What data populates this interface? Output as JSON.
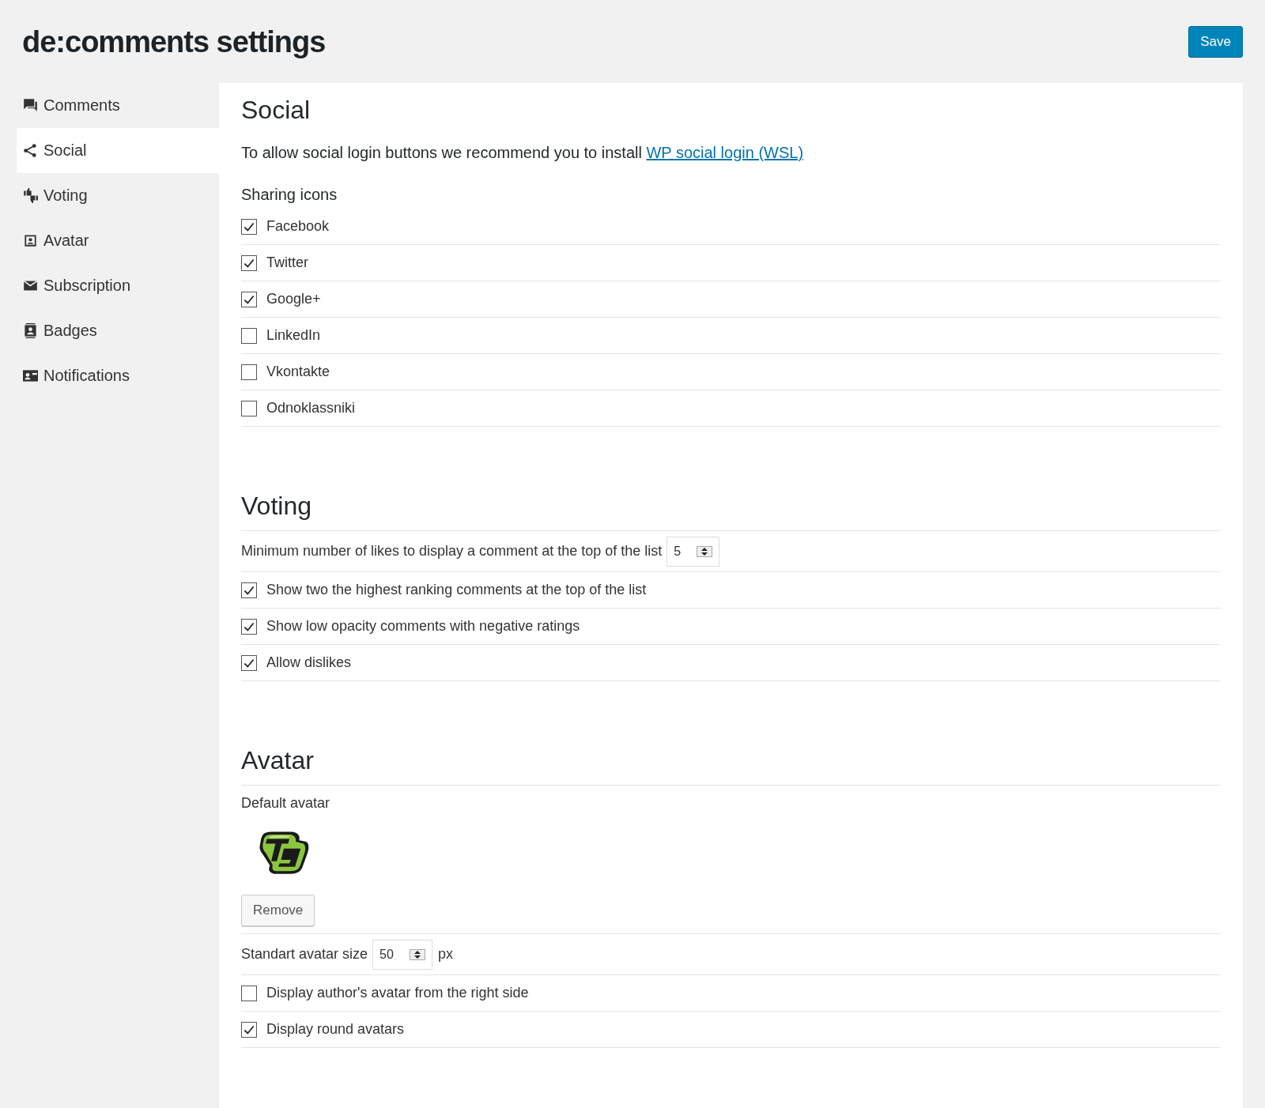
{
  "header": {
    "title": "de:comments settings",
    "save_button": "Save"
  },
  "sidebar": {
    "items": [
      {
        "label": "Comments",
        "selected": false
      },
      {
        "label": "Social",
        "selected": true
      },
      {
        "label": "Voting",
        "selected": false
      },
      {
        "label": "Avatar",
        "selected": false
      },
      {
        "label": "Subscription",
        "selected": false
      },
      {
        "label": "Badges",
        "selected": false
      },
      {
        "label": "Notifications",
        "selected": false
      }
    ]
  },
  "sections": [
    {
      "title": "Social",
      "rows": [
        {
          "kind": "paragraph",
          "text": "To allow social login buttons we recommend you to install",
          "link": "WP social login (WSL)"
        },
        {
          "kind": "subheading",
          "text": "Sharing icons"
        },
        {
          "kind": "checkbox",
          "label": "Facebook",
          "checked": true
        },
        {
          "kind": "checkbox",
          "label": "Twitter",
          "checked": true
        },
        {
          "kind": "checkbox",
          "label": "Google+",
          "checked": true
        },
        {
          "kind": "checkbox",
          "label": "LinkedIn",
          "checked": false
        },
        {
          "kind": "checkbox",
          "label": "Vkontakte",
          "checked": false
        },
        {
          "kind": "checkbox",
          "label": "Odnoklassniki",
          "checked": false
        }
      ]
    },
    {
      "title": "Voting",
      "rows": [
        {
          "kind": "number",
          "label": "Minimum number of likes to display a comment at the top of the list",
          "value": "5"
        },
        {
          "kind": "checkbox",
          "label": "Show two the highest ranking comments at the top of the list",
          "checked": true
        },
        {
          "kind": "checkbox",
          "label": "Show low opacity comments with negative ratings",
          "checked": true
        },
        {
          "kind": "checkbox",
          "label": "Allow dislikes",
          "checked": true
        }
      ]
    },
    {
      "title": "Avatar",
      "rows": [
        {
          "kind": "label",
          "text": "Default avatar"
        },
        {
          "kind": "picture"
        },
        {
          "kind": "button",
          "label": "Remove"
        },
        {
          "kind": "number",
          "label": "Standart avatar size",
          "value": "50",
          "unit": "px"
        },
        {
          "kind": "checkbox",
          "label": "Display author's avatar from the right side",
          "checked": false
        },
        {
          "kind": "checkbox",
          "label": "Display round avatars",
          "checked": true
        }
      ]
    }
  ]
}
